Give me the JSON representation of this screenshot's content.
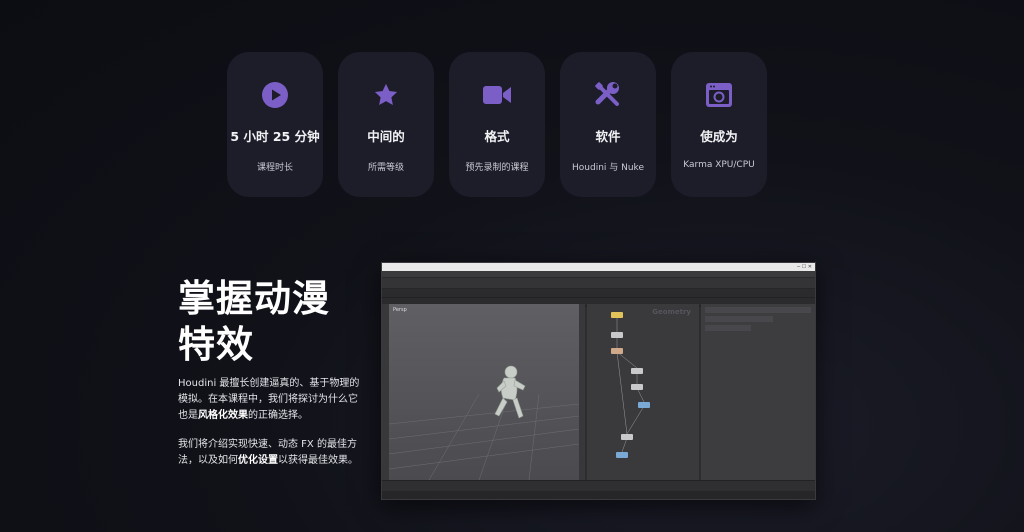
{
  "cards": [
    {
      "icon": "play-circle-icon",
      "value": "5 小时 25 分钟",
      "label": "课程时长"
    },
    {
      "icon": "star-icon",
      "value": "中间的",
      "label": "所需等级"
    },
    {
      "icon": "video-camera-icon",
      "value": "格式",
      "label": "预先录制的课程"
    },
    {
      "icon": "tools-icon",
      "value": "软件",
      "label": "Houdini 与 Nuke"
    },
    {
      "icon": "render-window-icon",
      "value": "使成为",
      "label": "Karma XPU/CPU"
    }
  ],
  "hero": {
    "title_line1": "掌握动漫",
    "title_line2": "特效",
    "p1_a": "Houdini 最擅长创建逼真的、基于物理的模拟。在本课程中，我们将探讨为什么它也是",
    "p1_b": "风格化效果",
    "p1_c": "的正确选择。",
    "p2_a": "我们将介绍实现快速、动态 FX 的最佳方法，以及如何",
    "p2_b": "优化设置",
    "p2_c": "以获得最佳效果。"
  },
  "screenshot": {
    "viewport_label": "Persp",
    "network_watermark": "Geometry"
  },
  "colors": {
    "accent": "#7b5fc7",
    "card_bg": "#1c1d29",
    "page_bg": "#111219"
  }
}
